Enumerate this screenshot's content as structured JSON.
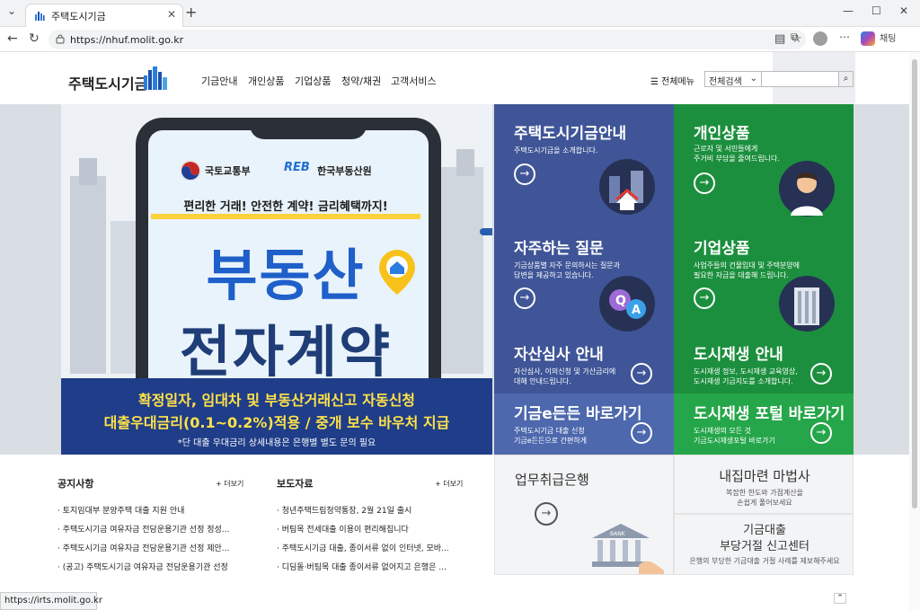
{
  "browser": {
    "tab_title": "주택도시기금",
    "url": "https://nhuf.molit.go.kr",
    "profile_label": "채팅",
    "status_url": "https://irts.molit.go.kr"
  },
  "header": {
    "logo": "주택도시기금",
    "nav": [
      "기금안내",
      "개인상품",
      "기업상품",
      "청약/채권",
      "고객서비스"
    ],
    "all_menu": "전체메뉴",
    "search_select": "전체검색"
  },
  "hero": {
    "org1": "국토교통부",
    "org2": "한국부동산원",
    "org2_logo": "REB",
    "slogan": "편리한 거래! 안전한 계약! 금리혜택까지!",
    "title1": "부동산",
    "title2": "전자계약",
    "footer1": "확정일자, 임대차 및 부동산거래신고 자동신청",
    "footer2": "대출우대금리(0.1~0.2%)적용 / 중개 보수 바우처 지급",
    "footnote": "*단 대출 우대금리 상세내용은 은행별 별도 문의 필요"
  },
  "tiles": [
    {
      "title": "주택도시기금안내",
      "desc": "주택도시기금을 소개합니다."
    },
    {
      "title": "개인상품",
      "desc": "근로자 및 서민들에게\n주거비 부담을 줄여드립니다."
    },
    {
      "title": "자주하는 질문",
      "desc": "기금상품별 자주 문의하시는 질문과\n답변을 제공하고 있습니다."
    },
    {
      "title": "기업상품",
      "desc": "사업주들의 건물임대 및 주택분양에\n필요한 자금을 대출해 드립니다."
    },
    {
      "title": "자산심사 안내",
      "desc": "자산심사, 이의신청 및 가산금리에\n대해 안내드립니다."
    },
    {
      "title": "도시재생 안내",
      "desc": "도시재생 정보, 도시재생 교육영상,\n도시재생 기금지도를 소개합니다."
    },
    {
      "title": "기금e든든 바로가기",
      "desc": "주택도시기금 대출 신청\n기금e든든으로 간편하게"
    },
    {
      "title": "도시재생 포털 바로가기",
      "desc": "도시재생의 모든 것\n기금도시재생포털 바로가기"
    }
  ],
  "notice": {
    "title": "공지사항",
    "more": "+ 더보기",
    "items": [
      "토지임대부 분양주택 대출 지원 안내",
      "주택도시기금 여유자금 전담운용기관 선정 정성...",
      "주택도시기금 여유자금 전담운용기관 선정 제안...",
      "(공고) 주택도시기금 여유자금 전담운용기관 선정"
    ]
  },
  "press": {
    "title": "보도자료",
    "more": "+ 더보기",
    "items": [
      "청년주택드림청약통장, 2월 21일 출시",
      "버팀목 전세대출 이용이 편리해집니다",
      "주택도시기금 대출, 종이서류 없이 인터넷, 모바...",
      "디딤돌·버팀목 대출 종이서류 없어지고 은행은 ..."
    ]
  },
  "cards": {
    "bank": "업무취급은행",
    "bank_sign": "BANK",
    "home_title": "내집마련 마법사",
    "home_desc": "복잡한 한도와 가점계산을\n손쉽게 풀어보세요",
    "report_title1": "기금대출",
    "report_title2": "부당거절 신고센터",
    "report_desc": "은행의 부당한 기금대출 거절 사례를 제보해주세요"
  }
}
